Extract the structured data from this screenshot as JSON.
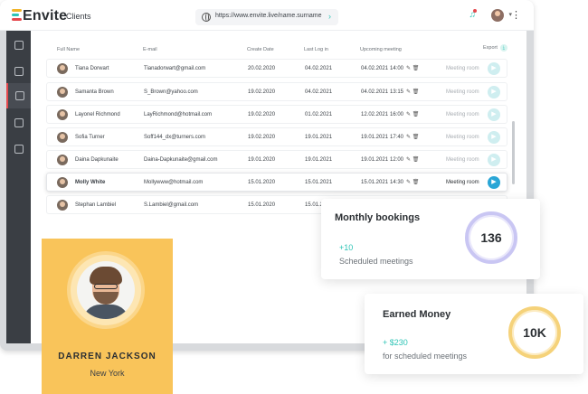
{
  "app": {
    "logo": "Envite",
    "page_title": "Clients",
    "url": "https://www.envite.live/name.surname"
  },
  "table": {
    "headers": [
      "Full Name",
      "E-mail",
      "Create Date",
      "Last Log in",
      "Upcoming meeting"
    ],
    "export_label": "Export",
    "rows": [
      {
        "name": "Tiana Dorwart",
        "email": "Tianadorwart@gmail.com",
        "created": "20.02.2020",
        "last_login": "04.02.2021",
        "meeting_date": "04.02.2021",
        "meeting_time": "14:00",
        "room": "Meeting room"
      },
      {
        "name": "Samanta Brown",
        "email": "S_Brown@yahoo.com",
        "created": "19.02.2020",
        "last_login": "04.02.2021",
        "meeting_date": "04.02.2021",
        "meeting_time": "13:15",
        "room": "Meeting room"
      },
      {
        "name": "Layonel Richmond",
        "email": "LayRichmond@hotmail.com",
        "created": "19.02.2020",
        "last_login": "01.02.2021",
        "meeting_date": "12.02.2021",
        "meeting_time": "16:00",
        "room": "Meeting room"
      },
      {
        "name": "Sofia Turner",
        "email": "Soff144_dx@turners.com",
        "created": "19.02.2020",
        "last_login": "19.01.2021",
        "meeting_date": "19.01.2021",
        "meeting_time": "17:40",
        "room": "Meeting room"
      },
      {
        "name": "Daina Dapkunaite",
        "email": "Daina-Dapkunaite@gmail.com",
        "created": "19.01.2020",
        "last_login": "19.01.2021",
        "meeting_date": "19.01.2021",
        "meeting_time": "12:00",
        "room": "Meeting room"
      },
      {
        "name": "Molly White",
        "email": "Mollywww@hotmail.com",
        "created": "15.01.2020",
        "last_login": "15.01.2021",
        "meeting_date": "15.01.2021",
        "meeting_time": "14:30",
        "room": "Meeting room"
      },
      {
        "name": "Stephan Lambiel",
        "email": "S.Lambiel@gmail.com",
        "created": "15.01.2020",
        "last_login": "15.01.2",
        "meeting_date": "",
        "meeting_time": "",
        "room": ""
      }
    ]
  },
  "profile": {
    "name": "DARREN JACKSON",
    "city": "New York"
  },
  "bookings_card": {
    "title": "Monthly bookings",
    "delta": "+10",
    "subtitle": "Scheduled meetings",
    "value": "136"
  },
  "money_card": {
    "title": "Earned Money",
    "delta": "+ $230",
    "subtitle": "for scheduled meetings",
    "value": "10K"
  },
  "colors": {
    "accent_teal": "#2ec4b6",
    "profile_bg": "#f9c45a",
    "sidebar_bg": "#3a3e44",
    "active_red": "#e5484d",
    "meeting_button": "#2aa6d6"
  },
  "icons": [
    "globe-icon",
    "chevron-right-icon",
    "bell-icon",
    "menu-dots-icon",
    "dashboard-icon",
    "monitor-icon",
    "users-icon",
    "contact-icon",
    "card-icon",
    "edit-icon",
    "trash-icon",
    "video-icon"
  ]
}
